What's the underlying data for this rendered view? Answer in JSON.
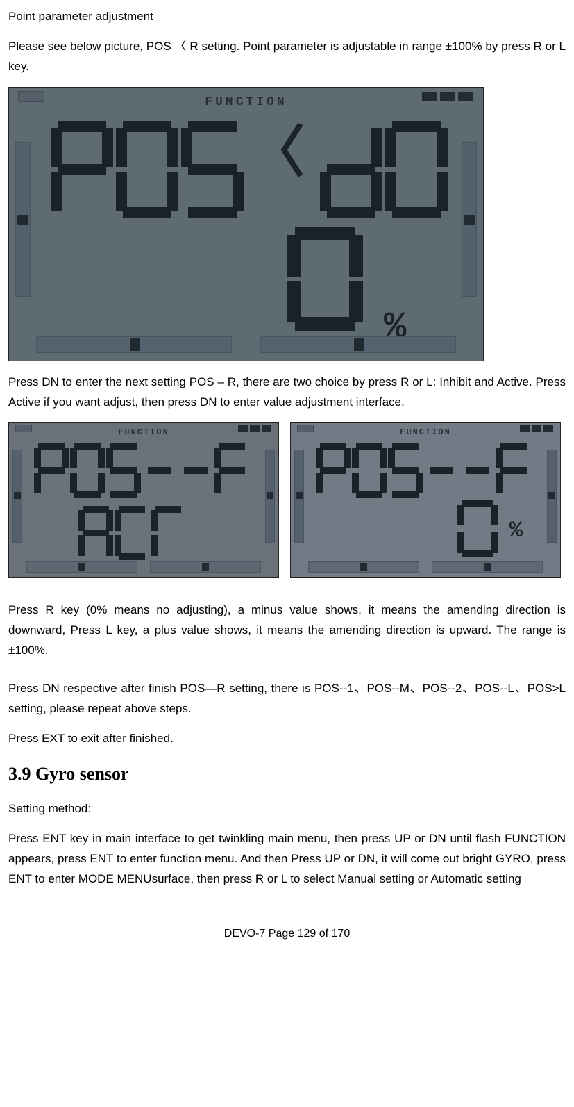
{
  "title_line": "Point parameter adjustment",
  "intro": "Please see below picture, POS 〈 R setting. Point parameter is adjustable in range ±100% by press R or L key.",
  "lcd_large": {
    "func_label": "FUNCTION",
    "line1_left": "POS",
    "separator": "〈",
    "line1_right": "DO",
    "value": "0",
    "value_suffix": "%"
  },
  "para_mid": "Press DN to enter the next setting POS – R, there are two choice by press R or L: Inhibit and Active. Press Active if you want adjust, then press DN to enter value adjustment interface.",
  "lcd_small_left": {
    "func_label": "FUNCTION",
    "line1": "POS--R",
    "line2": "ACT"
  },
  "lcd_small_right": {
    "func_label": "FUNCTION",
    "line1": "POS--R",
    "value": "0",
    "value_suffix": "%"
  },
  "para_direction": "Press R key (0% means no adjusting), a minus value shows, it means the amending direction is downward, Press L key, a plus value shows, it means the amending direction is upward. The range is ±100%.",
  "para_repeat": "Press DN respective after finish POS—R setting, there is POS--1、POS--M、POS--2、POS--L、POS>L setting, please repeat above steps.",
  "para_exit": "Press EXT to exit after finished.",
  "h2": "3.9 Gyro sensor",
  "setting_method": "Setting method:",
  "gyro_para": "Press ENT key in main interface to get twinkling main menu, then press UP or DN until flash FUNCTION appears, press ENT to enter function menu. And then Press UP or DN, it will come out bright GYRO, press ENT to enter MODE MENUsurface, then press R or L to select Manual setting or Automatic setting",
  "footer": "DEVO-7     Page 129 of 170"
}
